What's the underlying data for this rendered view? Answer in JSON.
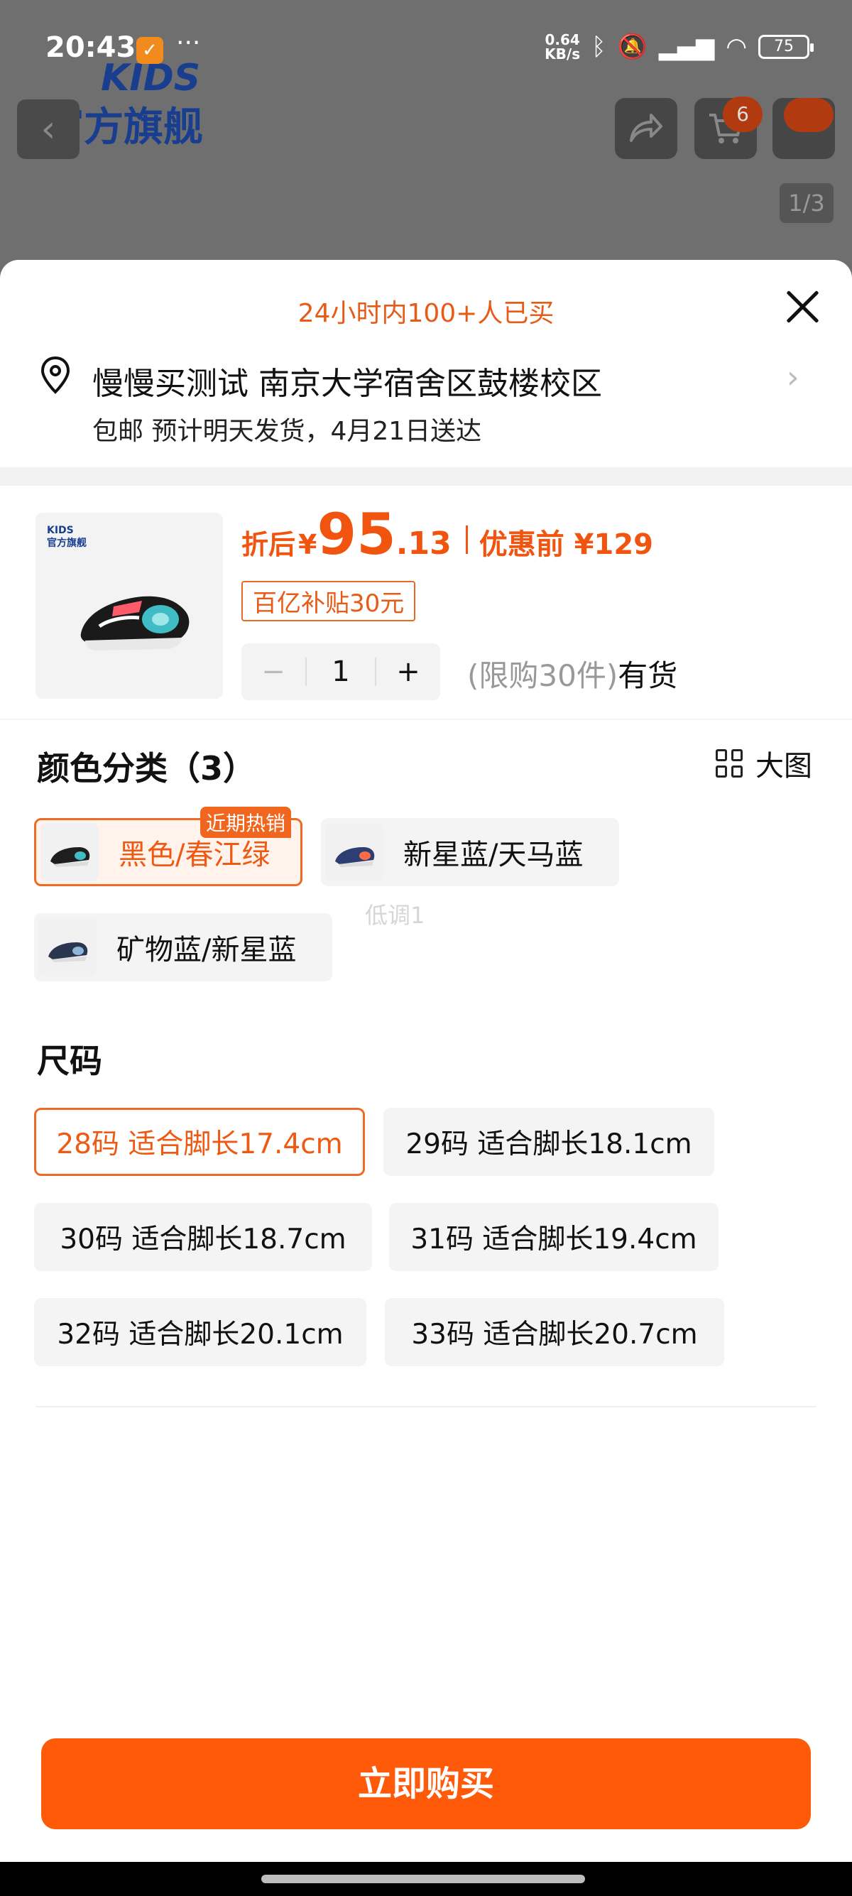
{
  "status_bar": {
    "time": "20:43",
    "app_icon": "notification-app-icon",
    "more": "···",
    "net_speed_value": "0.64",
    "net_speed_unit": "KB/s",
    "battery": "75"
  },
  "background_page": {
    "brand_kids": "KIDS",
    "brand_store": "官方旗舰",
    "cart_badge": "6",
    "pager": "1/3"
  },
  "sheet": {
    "hot_info": "24小时内100+人已买",
    "address": {
      "line1": "慢慢买测试 南京大学宿舍区鼓楼校区",
      "line2": "包邮 预计明天发货，4月21日送达"
    },
    "product": {
      "thumb_brand": "KIDS",
      "thumb_store": "官方旗舰",
      "price_label": "折后",
      "currency": "¥",
      "price_int": "95",
      "price_dec": ".13",
      "orig_label": "优惠前 ¥129",
      "subsidy": "百亿补贴30元",
      "quantity": "1",
      "minus": "−",
      "plus": "+",
      "limit_text": "(限购30件)",
      "stock_text": "有货"
    },
    "color_section": {
      "title": "颜色分类（3）",
      "big_image_label": "大图",
      "hot_tag": "近期热销",
      "price_drop_hint": "低调1",
      "options": [
        {
          "label": "黑色/春江绿",
          "selected": true
        },
        {
          "label": "新星蓝/天马蓝",
          "selected": false
        },
        {
          "label": "矿物蓝/新星蓝",
          "selected": false
        }
      ]
    },
    "size_section": {
      "title": "尺码",
      "options": [
        {
          "label": "28码  适合脚长17.4cm",
          "selected": true
        },
        {
          "label": "29码  适合脚长18.1cm",
          "selected": false
        },
        {
          "label": "30码  适合脚长18.7cm",
          "selected": false
        },
        {
          "label": "31码  适合脚长19.4cm",
          "selected": false
        },
        {
          "label": "32码  适合脚长20.1cm",
          "selected": false
        },
        {
          "label": "33码  适合脚长20.7cm",
          "selected": false
        }
      ]
    },
    "buy_button": "立即购买"
  },
  "colors": {
    "accent": "#ff5a0a",
    "price": "#f0540f",
    "selected_border": "#ee6a26"
  }
}
